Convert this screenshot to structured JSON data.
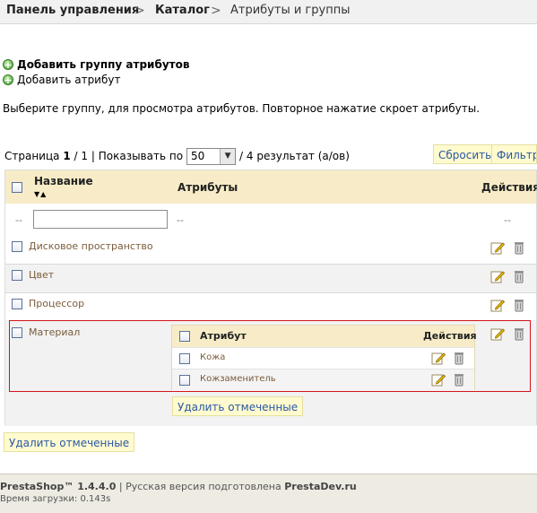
{
  "breadcrumb": {
    "dashboard": "Панель управления",
    "catalog": "Каталог",
    "current": "Атрибуты и группы",
    "separator": ">"
  },
  "actions": {
    "add_group": "Добавить группу атрибутов",
    "add_attribute": "Добавить атрибут",
    "add_icon": "add-circle-icon"
  },
  "hint": "Выберите группу, для просмотра атрибутов. Повторное нажатие скроет атрибуты.",
  "pager": {
    "page_label": "Страница",
    "page_current": "1",
    "page_sep": "/",
    "page_total": "1",
    "show_label": "| Показывать по",
    "per_page": "50",
    "results": "/ 4 результат (а/ов)"
  },
  "buttons": {
    "reset": "Сбросить",
    "filter": "Фильтр",
    "delete_selected": "Удалить отмеченные"
  },
  "table": {
    "headers": {
      "name": "Название",
      "attributes": "Атрибуты",
      "actions": "Действия"
    },
    "filter": {
      "dash_left": "--",
      "dash_mid": "--",
      "dash_right": "--",
      "name_value": ""
    },
    "rows": [
      {
        "name": "Дисковое пространство"
      },
      {
        "name": "Цвет"
      },
      {
        "name": "Процессор"
      },
      {
        "name": "Материал"
      }
    ],
    "sub_table": {
      "headers": {
        "attribute": "Атрибут",
        "actions": "Действия"
      },
      "rows": [
        {
          "name": "Кожа"
        },
        {
          "name": "Кожзаменитель"
        }
      ],
      "delete_selected": "Удалить отмеченные"
    }
  },
  "footer": {
    "brand": "PrestaShop™ 1.4.4.0",
    "sep": "|",
    "russian_label": "Русская версия подготовлена",
    "russian_by": "PrestaDev.ru",
    "load_time": "Время загрузки: 0.143s"
  },
  "colors": {
    "breadcrumb_bg": "#f1f1f1",
    "header_bg": "#f7ecc7",
    "button_bg": "#fffbcf",
    "button_text": "#2a57a5",
    "row_link": "#7b5c3a",
    "highlight_border": "#d4141c",
    "footer_bg": "#edebe2"
  }
}
